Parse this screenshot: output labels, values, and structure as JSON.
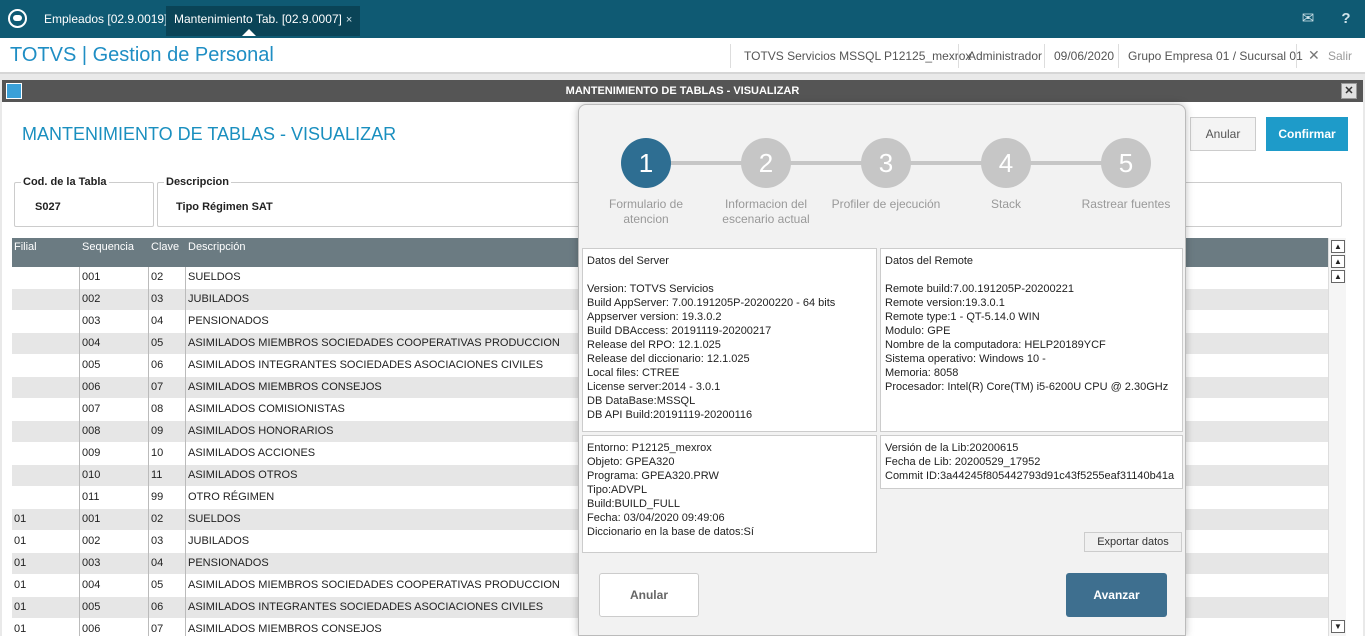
{
  "tabs": [
    {
      "label": "Empleados [02.9.0019]"
    },
    {
      "label": "Mantenimiento Tab. [02.9.0007]"
    }
  ],
  "tab_close": "×",
  "header": {
    "brand": "TOTVS | Gestion de Personal",
    "environment": "TOTVS Servicios MSSQL P12125_mexrox",
    "user": "Administrador",
    "date": "09/06/2020",
    "company": "Grupo Empresa 01 / Sucursal 01",
    "exit_label": "Salir"
  },
  "window": {
    "title": "MANTENIMIENTO DE TABLAS - VISUALIZAR",
    "page_title": "MANTENIMIENTO DE TABLAS - VISUALIZAR",
    "anular_label": "Anular",
    "confirmar_label": "Confirmar"
  },
  "fields": {
    "cod_label": "Cod. de la Tabla",
    "cod_value": "S027",
    "desc_label": "Descripcion",
    "desc_value": "Tipo Régimen SAT"
  },
  "table": {
    "headers": [
      "Filial",
      "Sequencia",
      "Clave",
      "Descripción"
    ],
    "rows": [
      [
        "",
        "001",
        "02",
        "SUELDOS"
      ],
      [
        "",
        "002",
        "03",
        "JUBILADOS"
      ],
      [
        "",
        "003",
        "04",
        "PENSIONADOS"
      ],
      [
        "",
        "004",
        "05",
        "ASIMILADOS MIEMBROS SOCIEDADES COOPERATIVAS PRODUCCION"
      ],
      [
        "",
        "005",
        "06",
        "ASIMILADOS INTEGRANTES SOCIEDADES ASOCIACIONES CIVILES"
      ],
      [
        "",
        "006",
        "07",
        "ASIMILADOS MIEMBROS CONSEJOS"
      ],
      [
        "",
        "007",
        "08",
        "ASIMILADOS COMISIONISTAS"
      ],
      [
        "",
        "008",
        "09",
        "ASIMILADOS HONORARIOS"
      ],
      [
        "",
        "009",
        "10",
        "ASIMILADOS ACCIONES"
      ],
      [
        "",
        "010",
        "11",
        "ASIMILADOS OTROS"
      ],
      [
        "",
        "011",
        "99",
        "OTRO RÉGIMEN"
      ],
      [
        "01",
        "001",
        "02",
        "SUELDOS"
      ],
      [
        "01",
        "002",
        "03",
        "JUBILADOS"
      ],
      [
        "01",
        "003",
        "04",
        "PENSIONADOS"
      ],
      [
        "01",
        "004",
        "05",
        "ASIMILADOS MIEMBROS SOCIEDADES COOPERATIVAS PRODUCCION"
      ],
      [
        "01",
        "005",
        "06",
        "ASIMILADOS INTEGRANTES SOCIEDADES ASOCIACIONES CIVILES"
      ],
      [
        "01",
        "006",
        "07",
        "ASIMILADOS MIEMBROS CONSEJOS"
      ]
    ]
  },
  "modal": {
    "steps": [
      {
        "num": "1",
        "label": "Formulario de atencion"
      },
      {
        "num": "2",
        "label": "Informacion del escenario actual"
      },
      {
        "num": "3",
        "label": "Profiler de ejecución"
      },
      {
        "num": "4",
        "label": "Stack"
      },
      {
        "num": "5",
        "label": "Rastrear fuentes"
      }
    ],
    "server_title": "Datos del Server",
    "server_lines": [
      "Version: TOTVS Servicios",
      "Build AppServer: 7.00.191205P-20200220 - 64 bits",
      "Appserver version: 19.3.0.2",
      "Build DBAccess: 20191119-20200217",
      "Release del RPO:  12.1.025",
      "Release del diccionario: 12.1.025",
      "Local files: CTREE",
      "License server:2014 - 3.0.1",
      "DB DataBase:MSSQL",
      "DB API Build:20191119-20200116"
    ],
    "remote_title": "Datos del Remote",
    "remote_lines": [
      "Remote build:7.00.191205P-20200221",
      "Remote version:19.3.0.1",
      "Remote type:1 - QT-5.14.0 WIN",
      "Modulo: GPE",
      "Nombre de la computadora: HELP20189YCF",
      "Sistema operativo: Windows 10 -",
      "Memoria: 8058",
      "Procesador: Intel(R) Core(TM) i5-6200U CPU @ 2.30GHz"
    ],
    "env_lines": [
      "Entorno: P12125_mexrox",
      "Objeto: GPEA320",
      "Programa: GPEA320.PRW",
      "Tipo:ADVPL",
      "Build:BUILD_FULL",
      "Fecha: 03/04/2020 09:49:06",
      "Diccionario en la base de datos:Sí"
    ],
    "lib_lines": [
      "Versión de la Lib:20200615",
      "Fecha de Lib: 20200529_17952",
      "Commit ID:3a44245f805442793d91c43f5255eaf31140b41a"
    ],
    "export_label": "Exportar datos",
    "anular_label": "Anular",
    "avanzar_label": "Avanzar"
  }
}
